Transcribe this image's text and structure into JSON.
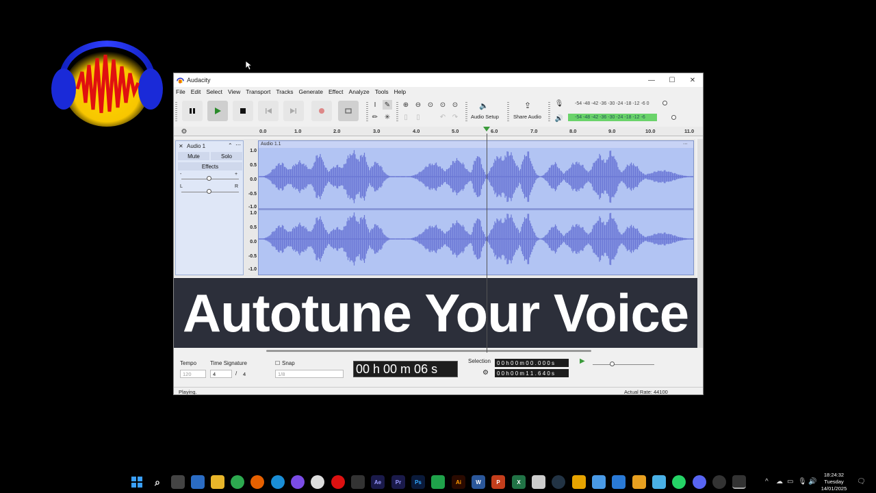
{
  "window": {
    "title": "Audacity"
  },
  "menu": [
    "File",
    "Edit",
    "Select",
    "View",
    "Transport",
    "Tracks",
    "Generate",
    "Effect",
    "Analyze",
    "Tools",
    "Help"
  ],
  "toolbar": {
    "audio_setup_label": "Audio Setup",
    "share_audio_label": "Share Audio",
    "rec_meter_scale": "-54 -48 -42 -36 -30 -24 -18 -12 -6 0",
    "play_meter_scale": "-54 -48 -42 -36 -30 -24 -18 -12 -6"
  },
  "ruler": {
    "ticks": [
      "0.0",
      "1.0",
      "2.0",
      "3.0",
      "4.0",
      "5.0",
      "6.0",
      "7.0",
      "8.0",
      "9.0",
      "10.0",
      "11.0"
    ]
  },
  "track": {
    "name": "Audio 1",
    "clip_name": "Audio 1.1",
    "mute_label": "Mute",
    "solo_label": "Solo",
    "effects_label": "Effects",
    "scale": [
      "1.0",
      "0.5",
      "0.0",
      "-0.5",
      "-1.0"
    ]
  },
  "banner": {
    "text": "Autotune Your Voice"
  },
  "bottom": {
    "tempo_label": "Tempo",
    "tempo_value": "120",
    "time_sig_label": "Time Signature",
    "time_sig_num": "4",
    "time_sig_den": "4",
    "snap_label": "Snap",
    "snap_value": "1/8",
    "time_display": "00 h 00 m 06 s",
    "selection_label": "Selection",
    "sel_start": "0 0 h 0 0 m 0 0 . 0 0 0 s",
    "sel_end": "0 0 h 0 0 m 1 1 . 6 4 0 s"
  },
  "status": {
    "left": "Playing.",
    "right": "Actual Rate: 44100"
  },
  "clock": {
    "time": "18:24:32",
    "day": "Tuesday",
    "date": "14/01/2025"
  },
  "colors": {
    "waveform": "#6a77d6",
    "wave_bg": "#b2c4f3",
    "banner_bg": "#2c2f3a",
    "meter": "#6ad36a"
  }
}
